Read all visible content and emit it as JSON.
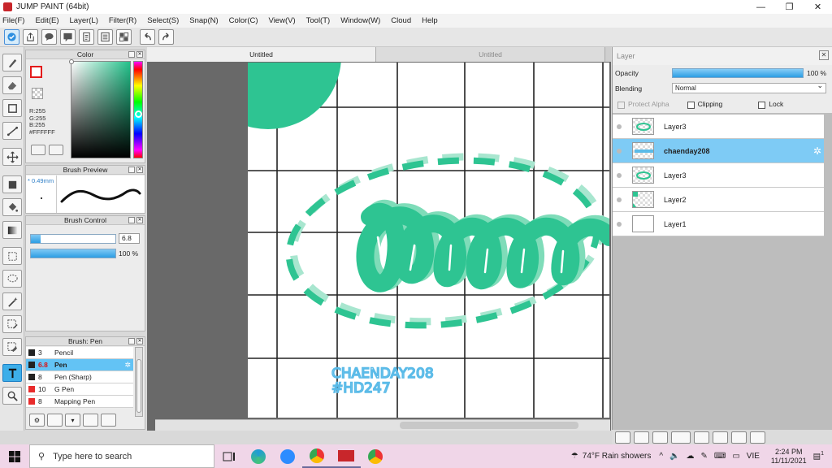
{
  "window": {
    "title": "JUMP PAINT (64bit)"
  },
  "menu": [
    "File(F)",
    "Edit(E)",
    "Layer(L)",
    "Filter(R)",
    "Select(S)",
    "Snap(N)",
    "Color(C)",
    "View(V)",
    "Tool(T)",
    "Window(W)",
    "Cloud",
    "Help"
  ],
  "color_panel": {
    "title": "Color",
    "r": "R:255",
    "g": "G:255",
    "b": "B:255",
    "hex": "#FFFFFF",
    "hue_color": "#24c28b"
  },
  "brush_preview": {
    "title": "Brush Preview",
    "size": "* 0.49mm"
  },
  "brush_control": {
    "title": "Brush Control",
    "size_value": "6.8",
    "opacity_value": "100 %",
    "size_fraction": 0.12,
    "opacity_fraction": 1.0
  },
  "brush_list": {
    "title": "Brush: Pen",
    "items": [
      {
        "num": "3",
        "name": "Pencil",
        "color": "#222222"
      },
      {
        "num": "6.8",
        "name": "Pen",
        "color": "#222222"
      },
      {
        "num": "8",
        "name": "Pen (Sharp)",
        "color": "#222222"
      },
      {
        "num": "10",
        "name": "G Pen",
        "color": "#e82b2b"
      },
      {
        "num": "8",
        "name": "Mapping Pen",
        "color": "#e82b2b"
      }
    ]
  },
  "tabs": [
    {
      "label": "Untitled"
    },
    {
      "label": "Untitled"
    }
  ],
  "canvas": {
    "artwork_color": "#2ec492",
    "signature_line1": "CHAENDAY208",
    "signature_line2": "#HD247",
    "signature_color": "#5bbbe8"
  },
  "layer_panel": {
    "title": "Layer",
    "opacity_label": "Opacity",
    "opacity_value": "100 %",
    "blending_label": "Blending",
    "blending_value": "Normal",
    "protect_alpha": "Protect Alpha",
    "clipping": "Clipping",
    "lock": "Lock",
    "layers": [
      {
        "name": "Layer3"
      },
      {
        "name": "chaenday208"
      },
      {
        "name": "Layer3"
      },
      {
        "name": "Layer2"
      },
      {
        "name": "Layer1"
      }
    ]
  },
  "taskbar": {
    "search_placeholder": "Type here to search",
    "weather": "74°F  Rain showers",
    "lang": "VIE",
    "time": "2:24 PM",
    "date": "11/11/2021",
    "notifications": "1"
  }
}
